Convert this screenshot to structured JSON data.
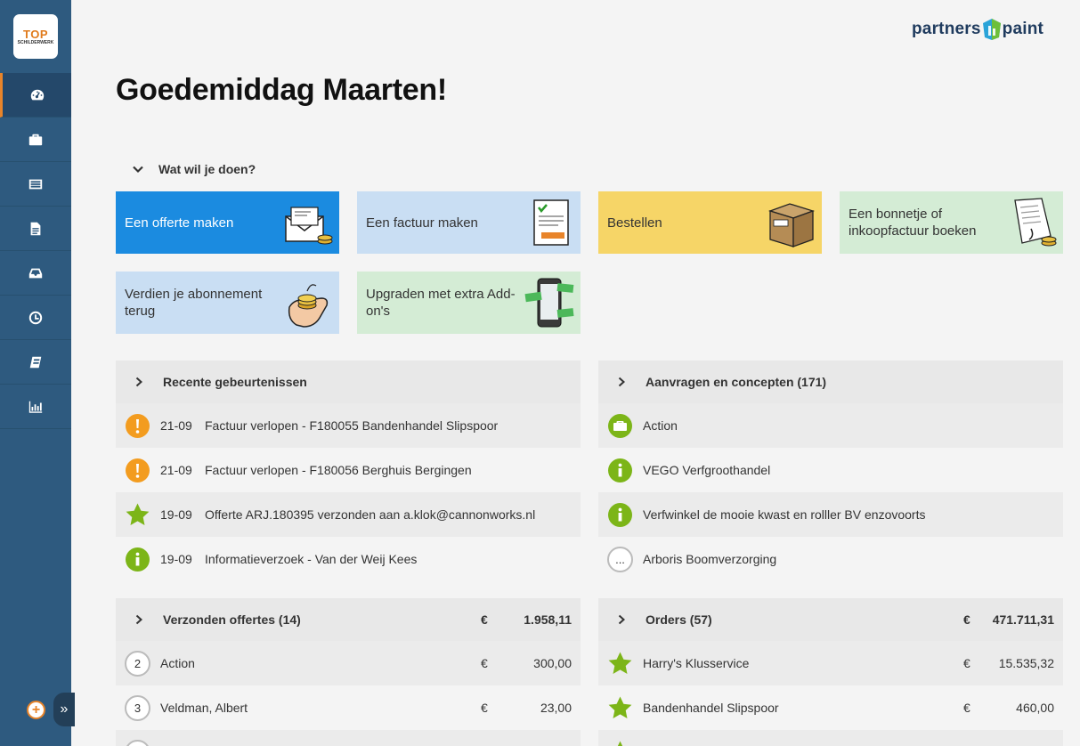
{
  "logo": {
    "main": "TOP",
    "sub": "SCHILDERWERK"
  },
  "brand": {
    "left": "partners",
    "right": "paint"
  },
  "greeting": "Goedemiddag Maarten!",
  "actions_section": "Wat wil je doen?",
  "tiles": [
    {
      "label": "Een offerte maken"
    },
    {
      "label": "Een factuur maken"
    },
    {
      "label": "Bestellen"
    },
    {
      "label": "Een bonnetje of inkoopfactuur boeken"
    },
    {
      "label": "Verdien je abonnement terug"
    },
    {
      "label": "Upgraden met extra Add-on's"
    }
  ],
  "recent": {
    "title": "Recente gebeurtenissen",
    "items": [
      {
        "date": "21-09",
        "text": "Factuur verlopen - F180055 Bandenhandel Slipspoor",
        "icon": "warning-icon"
      },
      {
        "date": "21-09",
        "text": "Factuur verlopen - F180056 Berghuis Bergingen",
        "icon": "warning-icon"
      },
      {
        "date": "19-09",
        "text": "Offerte ARJ.180395 verzonden aan a.klok@cannonworks.nl",
        "icon": "star-icon"
      },
      {
        "date": "19-09",
        "text": "Informatieverzoek - Van der Weij Kees",
        "icon": "info-icon"
      }
    ]
  },
  "requests": {
    "title": "Aanvragen en concepten (171)",
    "items": [
      {
        "text": "Action",
        "icon": "briefcase-icon"
      },
      {
        "text": "VEGO Verfgroothandel",
        "icon": "info-icon"
      },
      {
        "text": "Verfwinkel de mooie kwast en rolller BV enzovoorts",
        "icon": "info-icon"
      },
      {
        "text": "Arboris Boomverzorging",
        "icon": "ellipsis-icon",
        "badge": "..."
      }
    ]
  },
  "quotes": {
    "title": "Verzonden offertes (14)",
    "currency": "€",
    "total": "1.958,11",
    "items": [
      {
        "num": "2",
        "name": "Action",
        "currency": "€",
        "amount": "300,00"
      },
      {
        "num": "3",
        "name": "Veldman, Albert",
        "currency": "€",
        "amount": "23,00"
      }
    ]
  },
  "orders": {
    "title": "Orders (57)",
    "currency": "€",
    "total": "471.711,31",
    "items": [
      {
        "name": "Harry's Klusservice",
        "currency": "€",
        "amount": "15.535,32"
      },
      {
        "name": "Bandenhandel Slipspoor",
        "currency": "€",
        "amount": "460,00"
      }
    ]
  },
  "colors": {
    "sidebar": "#2e5a7f",
    "accent": "#e8842a",
    "primary": "#1b8be0",
    "warning": "#f39c1f",
    "success": "#7cb518"
  }
}
